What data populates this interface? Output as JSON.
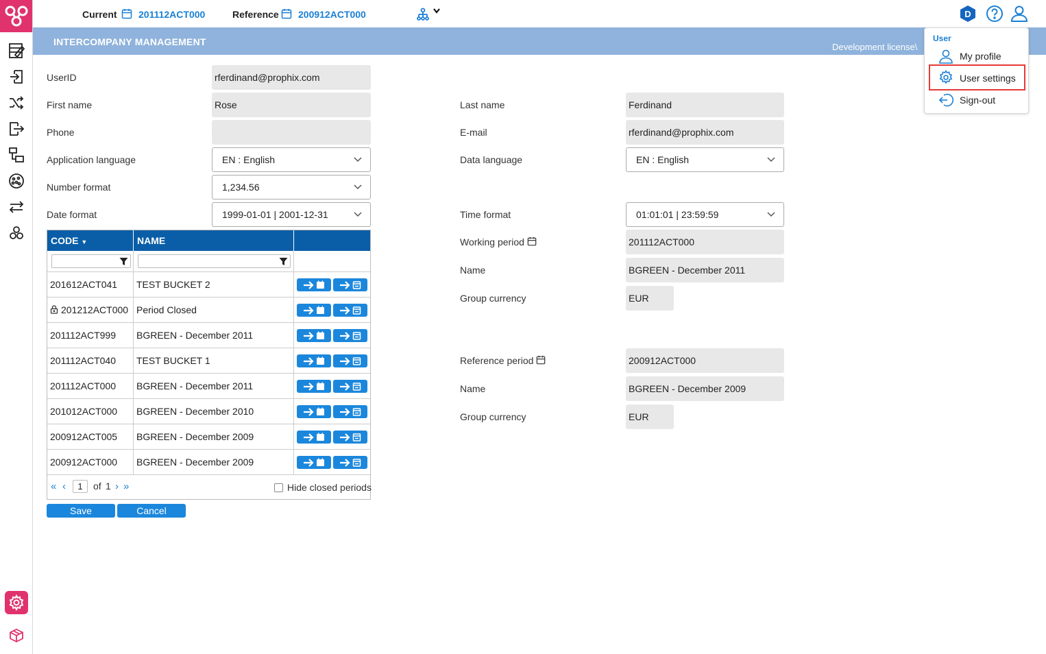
{
  "header": {
    "current_label": "Current",
    "current_value": "201112ACT000",
    "reference_label": "Reference",
    "reference_value": "200912ACT000",
    "avatar_letter": "D"
  },
  "title_bar": {
    "title": "INTERCOMPANY MANAGEMENT",
    "license_text": "Development license\\"
  },
  "user_menu": {
    "heading": "User",
    "items": [
      {
        "label": "My profile",
        "icon": "person-icon"
      },
      {
        "label": "User settings",
        "icon": "gear-icon",
        "highlighted": true
      },
      {
        "label": "Sign-out",
        "icon": "sign-out-icon"
      }
    ]
  },
  "form": {
    "userid_label": "UserID",
    "userid_value": "rferdinand@prophix.com",
    "firstname_label": "First name",
    "firstname_value": "Rose",
    "lastname_label": "Last name",
    "lastname_value": "Ferdinand",
    "phone_label": "Phone",
    "phone_value": "",
    "email_label": "E-mail",
    "email_value": "rferdinand@prophix.com",
    "app_language_label": "Application language",
    "app_language_value": "EN : English",
    "data_language_label": "Data language",
    "data_language_value": "EN : English",
    "number_format_label": "Number format",
    "number_format_value": "1,234.56",
    "date_format_label": "Date format",
    "date_format_value": "1999-01-01 | 2001-12-31",
    "time_format_label": "Time format",
    "time_format_value": "01:01:01 | 23:59:59"
  },
  "working_period": {
    "label": "Working period",
    "value": "201112ACT000",
    "name_label": "Name",
    "name_value": "BGREEN - December 2011",
    "currency_label": "Group currency",
    "currency_value": "EUR"
  },
  "reference_period": {
    "label": "Reference period",
    "value": "200912ACT000",
    "name_label": "Name",
    "name_value": "BGREEN - December 2009",
    "currency_label": "Group currency",
    "currency_value": "EUR"
  },
  "period_grid": {
    "columns": [
      "CODE",
      "NAME",
      ""
    ],
    "rows": [
      {
        "code": "201612ACT041",
        "name": "TEST BUCKET 2",
        "locked": false
      },
      {
        "code": "201212ACT000",
        "name": "Period Closed",
        "locked": true
      },
      {
        "code": "201112ACT999",
        "name": "BGREEN - December 2011",
        "locked": false
      },
      {
        "code": "201112ACT040",
        "name": "TEST BUCKET 1",
        "locked": false
      },
      {
        "code": "201112ACT000",
        "name": "BGREEN - December 2011",
        "locked": false
      },
      {
        "code": "201012ACT000",
        "name": "BGREEN - December 2010",
        "locked": false
      },
      {
        "code": "200912ACT005",
        "name": "BGREEN - December 2009",
        "locked": false
      },
      {
        "code": "200912ACT000",
        "name": "BGREEN - December 2009",
        "locked": false
      }
    ],
    "pager": {
      "page": "1",
      "of_label": "of",
      "total": "1"
    },
    "hide_closed_label": "Hide closed periods",
    "hide_closed_checked": false
  },
  "actions": {
    "save_label": "Save",
    "cancel_label": "Cancel"
  },
  "colors": {
    "brand": "#e0336e",
    "accent": "#1a7fd4",
    "header_blue": "#0a5ea8",
    "titlebar": "#8fb3dc"
  }
}
